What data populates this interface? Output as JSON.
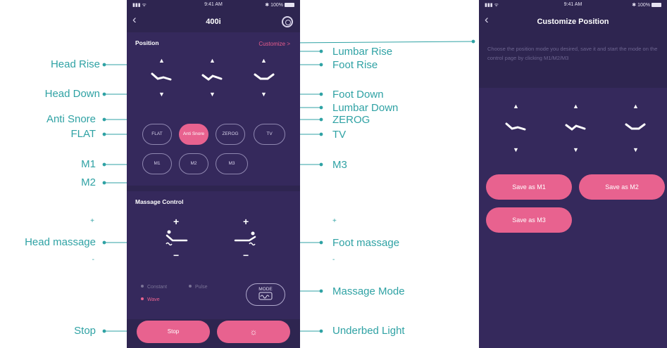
{
  "status": {
    "time": "9:41 AM",
    "battery": "100%"
  },
  "phone1": {
    "title": "400i",
    "position": {
      "title": "Position",
      "customize": "Customize >",
      "buttons": {
        "flat": "FLAT",
        "anti_snore": "Anti Snore",
        "zerog": "ZEROG",
        "tv": "TV",
        "m1": "M1",
        "m2": "M2",
        "m3": "M3"
      }
    },
    "massage": {
      "title": "Massage Control",
      "modes": [
        "Constant",
        "Pulse",
        "Wave"
      ],
      "mode_button": "MODE",
      "plus": "+",
      "minus": "−"
    },
    "stop": "Stop"
  },
  "phone2": {
    "title": "Customize Position",
    "description": "Choose the position mode you desired, save it and start the mode on the control page by clicking M1/M2/M3",
    "save_m1": "Save as M1",
    "save_m2": "Save as M2",
    "save_m3": "Save as M3"
  },
  "annotations": {
    "head_rise": "Head Rise",
    "head_down": "Head Down",
    "anti_snore": "Anti Snore",
    "flat": "FLAT",
    "m1": "M1",
    "m2": "M2",
    "plus": "+",
    "minus": "-",
    "head_massage": "Head massage",
    "stop": "Stop",
    "lumbar_rise": "Lumbar Rise",
    "foot_rise": "Foot Rise",
    "foot_down": "Foot Down",
    "lumbar_down": "Lumbar Down",
    "zerog": "ZEROG",
    "tv": "TV",
    "m3": "M3",
    "foot_massage": "Foot massage",
    "massage_mode": "Massage Mode",
    "underbed_light": "Underbed Light"
  },
  "colors": {
    "annotation": "#2fa2a4",
    "accent": "#e8628f",
    "background": "#2e2550",
    "panel": "#35295c"
  }
}
